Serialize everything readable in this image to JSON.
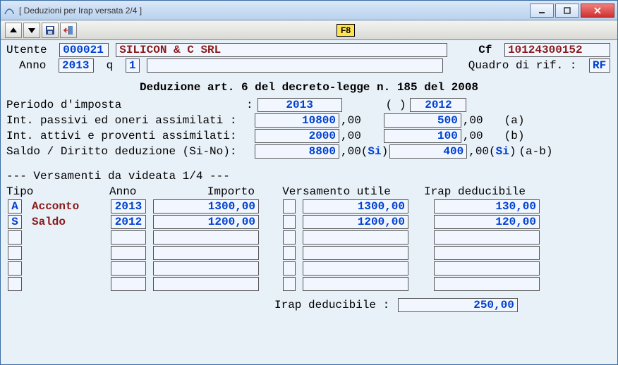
{
  "window": {
    "title": "[ Deduzioni per Irap versata 2/4 ]"
  },
  "toolbar": {
    "f8": "F8"
  },
  "header": {
    "utente_label": "Utente ",
    "utente_code": "000021",
    "utente_name": "SILICON & C SRL",
    "cf_label": "Cf ",
    "cf_value": "10124300152",
    "anno_label": "Anno ",
    "anno_value": "2013",
    "q_label": " q ",
    "q_value": "1",
    "quadro_label": "Quadro di rif. : ",
    "quadro_value": "RF"
  },
  "section_title": "Deduzione art. 6 del decreto-legge n. 185 del 2008",
  "taxperiod": {
    "label": "Periodo d'imposta",
    "colon": ":",
    "year1": "2013",
    "paren": "( )",
    "year2": "2012"
  },
  "calc": {
    "row1_label": "Int. passivi ed oneri assimilati :",
    "row1_a": "10800",
    "row1_a_suffix": ",00",
    "row1_b": "500",
    "row1_b_suffix": ",00",
    "row1_tag": "(a)",
    "row2_label": "Int. attivi e proventi assimilati:",
    "row2_a": "2000",
    "row2_a_suffix": ",00",
    "row2_b": "100",
    "row2_b_suffix": ",00",
    "row2_tag": "(b)",
    "row3_label": "Saldo / Diritto deduzione (Si-No):",
    "row3_a": "8800",
    "row3_a_suffix": ",00(",
    "row3_a_si": "Si",
    "row3_a_close": ")",
    "row3_b": "400",
    "row3_b_suffix": ",00(",
    "row3_b_si": "Si",
    "row3_b_close": ")",
    "row3_tag": "(a-b)"
  },
  "grid": {
    "title": "--- Versamenti da videata 1/4 ---",
    "col_tipo": "Tipo",
    "col_anno": "Anno",
    "col_importo": "Importo",
    "col_vers": "Versamento utile",
    "col_irap": "Irap deducibile",
    "rows": [
      {
        "code": "A",
        "tipo": "Acconto",
        "anno": "2013",
        "importo": "1300,00",
        "versutile": "1300,00",
        "irap": "130,00"
      },
      {
        "code": "S",
        "tipo": "Saldo",
        "anno": "2012",
        "importo": "1200,00",
        "versutile": "1200,00",
        "irap": "120,00"
      },
      {
        "code": "",
        "tipo": "",
        "anno": "",
        "importo": "",
        "versutile": "",
        "irap": ""
      },
      {
        "code": "",
        "tipo": "",
        "anno": "",
        "importo": "",
        "versutile": "",
        "irap": ""
      },
      {
        "code": "",
        "tipo": "",
        "anno": "",
        "importo": "",
        "versutile": "",
        "irap": ""
      },
      {
        "code": "",
        "tipo": "",
        "anno": "",
        "importo": "",
        "versutile": "",
        "irap": ""
      }
    ]
  },
  "total": {
    "label": "Irap deducibile : ",
    "value": "250,00"
  }
}
